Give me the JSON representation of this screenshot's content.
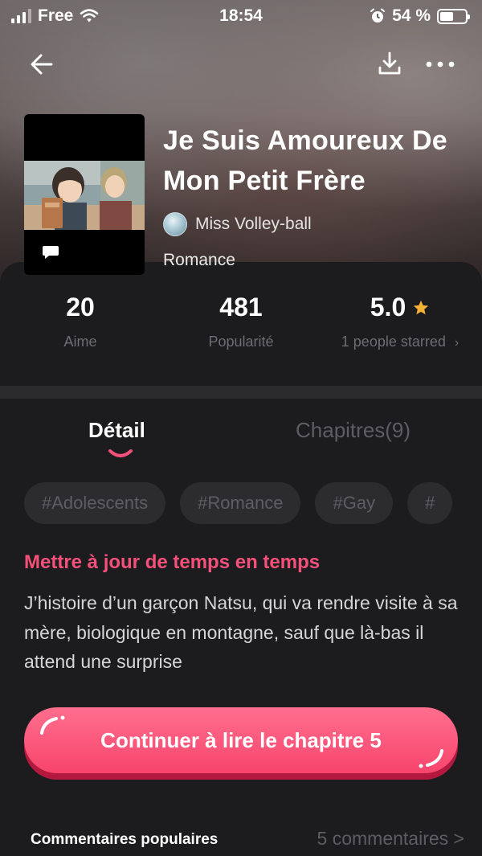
{
  "status_bar": {
    "carrier": "Free",
    "time": "18:54",
    "battery_percent": "54 %",
    "battery_level": 0.54
  },
  "nav": {
    "back_icon": "arrow-left-icon",
    "download_icon": "download-icon",
    "more_icon": "more-horizontal-icon"
  },
  "book": {
    "title": "Je Suis Amoureux De Mon Petit Frère",
    "author": "Miss Volley-ball",
    "genre": "Romance"
  },
  "stats": [
    {
      "value": "20",
      "label": "Aime"
    },
    {
      "value": "481",
      "label": "Popularité"
    },
    {
      "value": "5.0",
      "label": "1 people starred",
      "chevron": "›"
    }
  ],
  "tabs": {
    "detail": "Détail",
    "chapters": "Chapitres(9)"
  },
  "tags": [
    "#Adolescents",
    "#Romance",
    "#Gay",
    "#"
  ],
  "update_note": "Mettre à jour de temps en temps",
  "synopsis": "J’histoire d’un garçon Natsu, qui va rendre visite à sa mère, biologique en montagne, sauf que là-bas il attend une surprise",
  "cta": {
    "label": "Continuer à lire le chapitre 5"
  },
  "comments": {
    "title": "Commentaires populaires",
    "count": "5 commentaires >"
  },
  "colors": {
    "accent": "#f5507a",
    "star": "#f5b133",
    "background": "#1c1c1e"
  }
}
